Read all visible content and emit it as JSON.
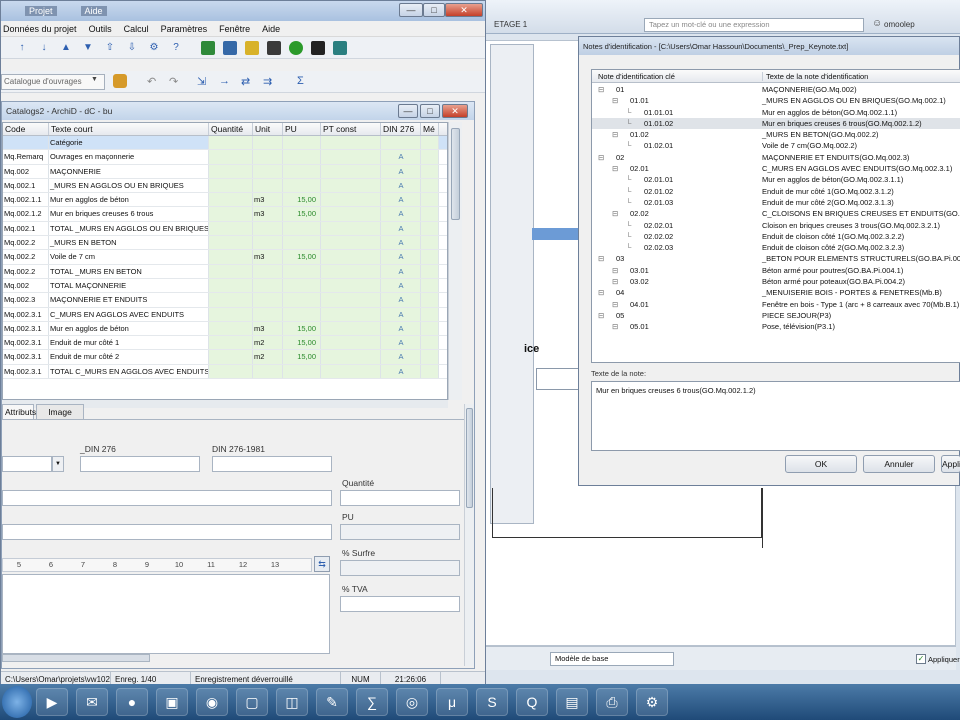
{
  "main_window": {
    "title_parts": [
      "",
      "Projet",
      "Aide"
    ],
    "menu": [
      "Données du projet",
      "Outils",
      "Calcul",
      "Paramètres",
      "Fenêtre",
      "Aide"
    ],
    "catalog_select": "Catalogue d'ouvrages",
    "toolbar_chars": [
      "↑",
      "↓",
      "▲",
      "▼",
      "⇧",
      "⇩",
      "⚙",
      "?"
    ],
    "arrow_chars": [
      "↶",
      "↷",
      "⇲",
      "→",
      "⇄",
      "⇉",
      "Σ"
    ]
  },
  "catalog_panel": {
    "title": "Catalogs2 - ArchiD - dC - bu",
    "columns": [
      "Code",
      "Texte court",
      "Quantité",
      "Unit",
      "PU",
      "PT const",
      "DIN 276",
      "Mé"
    ],
    "rows": [
      {
        "code": "",
        "text": "Catégorie",
        "unit": "",
        "pu": "",
        "din": ""
      },
      {
        "code": "Mq.Remarq",
        "text": "Ouvrages en maçonnerie",
        "unit": "",
        "pu": "",
        "din": "A"
      },
      {
        "code": "Mq.002",
        "text": "MAÇONNERIE",
        "unit": "",
        "pu": "",
        "din": "A"
      },
      {
        "code": "Mq.002.1",
        "text": "_MURS EN AGGLOS OU EN BRIQUES",
        "unit": "",
        "pu": "",
        "din": "A"
      },
      {
        "code": "Mq.002.1.1",
        "text": "Mur en agglos de béton",
        "unit": "m3",
        "pu": "15,00",
        "din": "A"
      },
      {
        "code": "Mq.002.1.2",
        "text": "Mur en briques creuses 6 trous",
        "unit": "m3",
        "pu": "15,00",
        "din": "A"
      },
      {
        "code": "Mq.002.1",
        "text": "TOTAL _MURS EN AGGLOS OU EN BRIQUES",
        "unit": "",
        "pu": "",
        "din": "A"
      },
      {
        "code": "Mq.002.2",
        "text": "_MURS EN BETON",
        "unit": "",
        "pu": "",
        "din": "A"
      },
      {
        "code": "Mq.002.2",
        "text": "Voile de 7 cm",
        "unit": "m3",
        "pu": "15,00",
        "din": "A"
      },
      {
        "code": "Mq.002.2",
        "text": "TOTAL _MURS EN BETON",
        "unit": "",
        "pu": "",
        "din": "A"
      },
      {
        "code": "Mq.002",
        "text": "TOTAL MAÇONNERIE",
        "unit": "",
        "pu": "",
        "din": "A"
      },
      {
        "code": "Mq.002.3",
        "text": "MAÇONNERIE ET ENDUITS",
        "unit": "",
        "pu": "",
        "din": "A"
      },
      {
        "code": "Mq.002.3.1",
        "text": "C_MURS EN AGGLOS AVEC ENDUITS",
        "unit": "",
        "pu": "",
        "din": "A"
      },
      {
        "code": "Mq.002.3.1",
        "text": "Mur en agglos de béton",
        "unit": "m3",
        "pu": "15,00",
        "din": "A"
      },
      {
        "code": "Mq.002.3.1",
        "text": "Enduit de mur côté 1",
        "unit": "m2",
        "pu": "15,00",
        "din": "A"
      },
      {
        "code": "Mq.002.3.1",
        "text": "Enduit de mur côté 2",
        "unit": "m2",
        "pu": "15,00",
        "din": "A"
      },
      {
        "code": "Mq.002.3.1",
        "text": "TOTAL C_MURS EN AGGLOS AVEC ENDUITS",
        "unit": "",
        "pu": "",
        "din": "A"
      }
    ],
    "tabs": [
      "Attributs",
      "Image"
    ],
    "labels": {
      "din276": "_DIN 276",
      "din276_1981": "DIN 276-1981",
      "quantite": "Quantité",
      "pu": "PU",
      "surface": "% Surfre",
      "tva": "% TVA"
    },
    "ruler": [
      "5",
      "6",
      "7",
      "8",
      "9",
      "10",
      "11",
      "12",
      "13"
    ]
  },
  "statusbar": [
    "C:\\Users\\Omar\\projets\\vw1026.dbf",
    "Enreg. 1/40",
    "Enregistrement déverrouillé",
    "NUM",
    "21:26:06"
  ],
  "notes_dialog": {
    "title": "Notes d'identification - [C:\\Users\\Omar Hassoun\\Documents\\_Prep_Keynote.txt]",
    "col1": "Note d'identification clé",
    "col2": "Texte de la note d'identification",
    "rows": [
      {
        "level": 0,
        "key": "01",
        "text": "MAÇONNERIE(GO.Mq.002)"
      },
      {
        "level": 1,
        "key": "01.01",
        "text": "_MURS EN AGGLOS OU EN BRIQUES(GO.Mq.002.1)"
      },
      {
        "level": 2,
        "key": "01.01.01",
        "text": "Mur en agglos de béton(GO.Mq.002.1.1)"
      },
      {
        "level": 2,
        "key": "01.01.02",
        "text": "Mur en briques creuses 6 trous(GO.Mq.002.1.2)",
        "selected": true
      },
      {
        "level": 1,
        "key": "01.02",
        "text": "_MURS EN BETON(GO.Mq.002.2)"
      },
      {
        "level": 2,
        "key": "01.02.01",
        "text": "Voile de 7 cm(GO.Mq.002.2)"
      },
      {
        "level": 0,
        "key": "02",
        "text": "MAÇONNERIE ET ENDUITS(GO.Mq.002.3)"
      },
      {
        "level": 1,
        "key": "02.01",
        "text": "C_MURS EN AGGLOS AVEC ENDUITS(GO.Mq.002.3.1)"
      },
      {
        "level": 2,
        "key": "02.01.01",
        "text": "Mur en agglos de béton(GO.Mq.002.3.1.1)"
      },
      {
        "level": 2,
        "key": "02.01.02",
        "text": "Enduit de mur côté 1(GO.Mq.002.3.1.2)"
      },
      {
        "level": 2,
        "key": "02.01.03",
        "text": "Enduit de mur côté 2(GO.Mq.002.3.1.3)"
      },
      {
        "level": 1,
        "key": "02.02",
        "text": "C_CLOISONS EN BRIQUES CREUSES ET ENDUITS(GO.Mq.002.3.2)"
      },
      {
        "level": 2,
        "key": "02.02.01",
        "text": "Cloison en briques creuses 3 trous(GO.Mq.002.3.2.1)"
      },
      {
        "level": 2,
        "key": "02.02.02",
        "text": "Enduit de cloison côté 1(GO.Mq.002.3.2.2)"
      },
      {
        "level": 2,
        "key": "02.02.03",
        "text": "Enduit de cloison côté 2(GO.Mq.002.3.2.3)"
      },
      {
        "level": 0,
        "key": "03",
        "text": "_BETON POUR ELEMENTS STRUCTURELS(GO.BA.Pi.004)"
      },
      {
        "level": 1,
        "key": "03.01",
        "text": "Béton armé pour poutres(GO.BA.Pi.004.1)"
      },
      {
        "level": 1,
        "key": "03.02",
        "text": "Béton armé pour poteaux(GO.BA.Pi.004.2)"
      },
      {
        "level": 0,
        "key": "04",
        "text": "_MENUISERIE BOIS - PORTES & FENETRES(Mb.B)"
      },
      {
        "level": 1,
        "key": "04.01",
        "text": "Fenêtre en bois - Type 1 (arc + 8 carreaux avec 70(Mb.B.1)"
      },
      {
        "level": 0,
        "key": "05",
        "text": "PIECE SEJOUR(P3)"
      },
      {
        "level": 1,
        "key": "05.01",
        "text": "Pose, télévision(P3.1)"
      }
    ],
    "note_label": "Texte de la note:",
    "note_text": "Mur en briques creuses 6 trous(GO.Mq.002.1.2)",
    "ok": "OK",
    "cancel": "Annuler",
    "apply": "Appliquer"
  },
  "background_app": {
    "tab_label": "ETAGE 1",
    "search_placeholder": "Tapez un mot-clé ou une expression",
    "user": "omoolep",
    "model_select": "Modèle de base",
    "apply_check": "Appliquer",
    "partial_text": "ice"
  },
  "taskbar_icons": [
    "start",
    "media",
    "outlook",
    "firefox",
    "onenote",
    "mozilla",
    "sticky",
    "folder",
    "pdf",
    "calc",
    "chrome",
    "ubuntu",
    "skype",
    "qgis",
    "settings",
    "printer"
  ]
}
